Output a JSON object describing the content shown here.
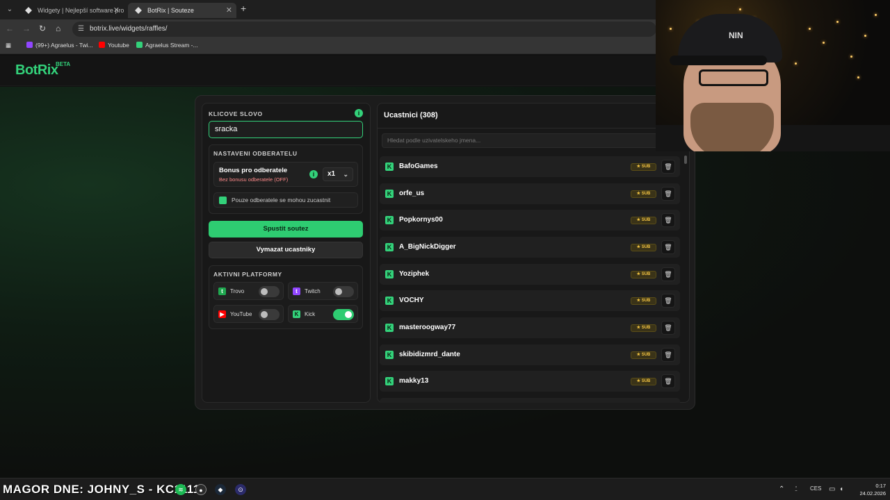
{
  "browser": {
    "tabs": [
      {
        "title": "Widgety | Nejlepší software pro"
      },
      {
        "title": "BotRix | Souteze"
      }
    ],
    "url": "botrix.live/widgets/raffles/",
    "bookmarks": [
      {
        "label": "(99+) Agraelus - Twi...",
        "color": "#9146ff"
      },
      {
        "label": "Youtube",
        "color": "#ff0000"
      },
      {
        "label": "Agraelus Stream -...",
        "color": "#33d17a"
      }
    ]
  },
  "app": {
    "logo": "BotRix",
    "beta": "BETA",
    "accent": "#33d17a"
  },
  "left": {
    "keyword_title": "KLICOVE SLOVO",
    "keyword_value": "sracka",
    "subs_title": "NASTAVENI ODBERATELU",
    "bonus_title": "Bonus pro odberatele",
    "bonus_sub": "Bez bonusu odberatele (OFF)",
    "multiplier": "x1",
    "subs_only_label": "Pouze odberatele se mohou zucastnit",
    "start_button": "Spustit soutez",
    "clear_button": "Vymazat ucastniky",
    "platforms_title": "AKTIVNI PLATFORMY",
    "platforms": [
      {
        "name": "Trovo",
        "enabled": false,
        "color": "#1fa84f"
      },
      {
        "name": "Twitch",
        "enabled": false,
        "color": "#9146ff"
      },
      {
        "name": "YouTube",
        "enabled": false,
        "color": "#ff0000"
      },
      {
        "name": "Kick",
        "enabled": true,
        "color": "#33d17a"
      }
    ]
  },
  "participants": {
    "title": "Ucastnici (308)",
    "search_placeholder": "Hledat podle uzivatelskeho jmena...",
    "sub_badge": "SUB",
    "rows": [
      {
        "name": "BafoGames"
      },
      {
        "name": "orfe_us"
      },
      {
        "name": "Popkornys00"
      },
      {
        "name": "A_BigNickDigger"
      },
      {
        "name": "Yoziphek"
      },
      {
        "name": "VOCHY"
      },
      {
        "name": "masteroogway77"
      },
      {
        "name": "skibidizmrd_dante"
      },
      {
        "name": "makky13"
      }
    ]
  },
  "taskbar": {
    "ticker": "MAGOR DNE: JOHNY_S - KC1111",
    "lang": "CES",
    "time": "0:17",
    "date": "24.02.2026"
  }
}
